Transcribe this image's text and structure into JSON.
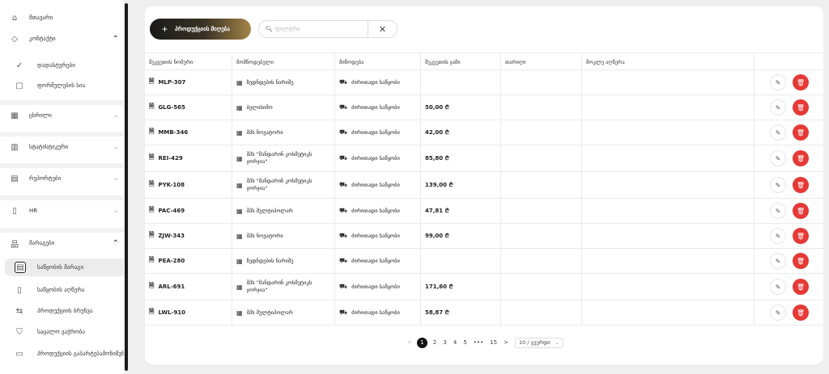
{
  "sidebar": {
    "items": [
      {
        "id": "home",
        "label": "მთავარი",
        "icon": "home-icon",
        "glyph": "⌂"
      },
      {
        "id": "tags",
        "label": "კონტაქტი",
        "icon": "tag-icon",
        "glyph": "◇",
        "chevron": "up"
      },
      {
        "id": "confirm",
        "label": "დადასტურები",
        "icon": "check-circle-icon",
        "glyph": "✓",
        "sub": true
      },
      {
        "id": "contacts",
        "label": "ფორმულების სია",
        "icon": "calendar-icon",
        "glyph": "▢",
        "sub": true
      },
      {
        "id": "catalog",
        "label": "ცხრილი",
        "icon": "grid-icon",
        "glyph": "▦",
        "chevron": "down"
      },
      {
        "id": "stats",
        "label": "სტატისტიკური",
        "icon": "chart-icon",
        "glyph": "▥",
        "chevron": "down"
      },
      {
        "id": "reports",
        "label": "რეპორტები",
        "icon": "document-icon",
        "glyph": "▤",
        "chevron": "down"
      },
      {
        "id": "hr",
        "label": "HR",
        "icon": "bookmark-icon",
        "glyph": "▯",
        "chevron": "down"
      },
      {
        "id": "warehouse",
        "label": "მარაგები",
        "icon": "warehouse-icon",
        "glyph": "品",
        "chevron": "up"
      },
      {
        "id": "stock",
        "label": "საწყობის მარაგი",
        "icon": "inventory-icon",
        "glyph": "▤",
        "sub": true,
        "active": true
      },
      {
        "id": "stock-desc",
        "label": "საწყობის აღწერა",
        "icon": "file-icon",
        "glyph": "▯",
        "sub": true
      },
      {
        "id": "transfer",
        "label": "პროდუქციის ბრუნვა",
        "icon": "transfer-icon",
        "glyph": "⇆",
        "sub": true
      },
      {
        "id": "cart",
        "label": "საცალო ვაჭრობა",
        "icon": "cart-icon",
        "glyph": "⛉",
        "sub": true
      },
      {
        "id": "disposal",
        "label": "პროდუქციის გაბარტებამონიშვნა",
        "icon": "trash-icon",
        "glyph": "▭",
        "sub": true
      }
    ]
  },
  "toolbar": {
    "add_label": "პროდუქციის მიღება",
    "search_placeholder": "ფილტრი",
    "search_value": ""
  },
  "table": {
    "columns": [
      "შეკვეთის ნომერი",
      "მომწოდებელი",
      "მიწოდება",
      "შეკვეთის ჯამი",
      "თარიღი",
      "მოკლე აღწერა"
    ],
    "rows": [
      {
        "code": "MLP-307",
        "supplier": "ზედნდების ნარიშე",
        "warehouse": "ძირითადი საწყობი",
        "total": "",
        "tall": false
      },
      {
        "code": "GLG-565",
        "supplier": "ბელისიმო",
        "warehouse": "ძირითადი საწყობი",
        "total": "50,00 ₾",
        "tall": false
      },
      {
        "code": "MMB-346",
        "supplier": "შპს ნოვატორი",
        "warehouse": "ძირითადი საწყობი",
        "total": "42,00 ₾",
        "tall": false
      },
      {
        "code": "REI-429",
        "supplier": "შპს \"მანდარინ კოსმეტიკს ჯორჯია\"",
        "warehouse": "ძირითადი საწყობი",
        "total": "85,80 ₾",
        "tall": true
      },
      {
        "code": "PYK-108",
        "supplier": "შპს \"მანდარინ კოსმეტიკს ჯორჯია\"",
        "warehouse": "ძირითადი საწყობი",
        "total": "139,00 ₾",
        "tall": true
      },
      {
        "code": "PAC-469",
        "supplier": "შპს მულტიპოლარ",
        "warehouse": "ძირითადი საწყობი",
        "total": "47,81 ₾",
        "tall": false
      },
      {
        "code": "ZJW-343",
        "supplier": "შპს ნოვატორი",
        "warehouse": "ძირითადი საწყობი",
        "total": "99,00 ₾",
        "tall": false
      },
      {
        "code": "PEA-280",
        "supplier": "ზედნდების ნარიშე",
        "warehouse": "ძირითადი საწყობი",
        "total": "",
        "tall": false
      },
      {
        "code": "ARL-691",
        "supplier": "შპს \"მანდარინ კოსმეტიკს ჯორჯია\"",
        "warehouse": "ძირითადი საწყობი",
        "total": "171,60 ₾",
        "tall": true
      },
      {
        "code": "LWL-910",
        "supplier": "შპს მულტიპოლარ",
        "warehouse": "ძირითადი საწყობი",
        "total": "58,87 ₾",
        "tall": false
      }
    ]
  },
  "pagination": {
    "prev": "<",
    "pages": [
      "1",
      "2",
      "3",
      "4",
      "5",
      "•••",
      "15"
    ],
    "current": "1",
    "next": ">",
    "page_size": "10 / გვერდი"
  },
  "colors": {
    "delete": "#e53935",
    "primary_dark": "#1a1a1a",
    "primary_gold": "#a58547"
  }
}
